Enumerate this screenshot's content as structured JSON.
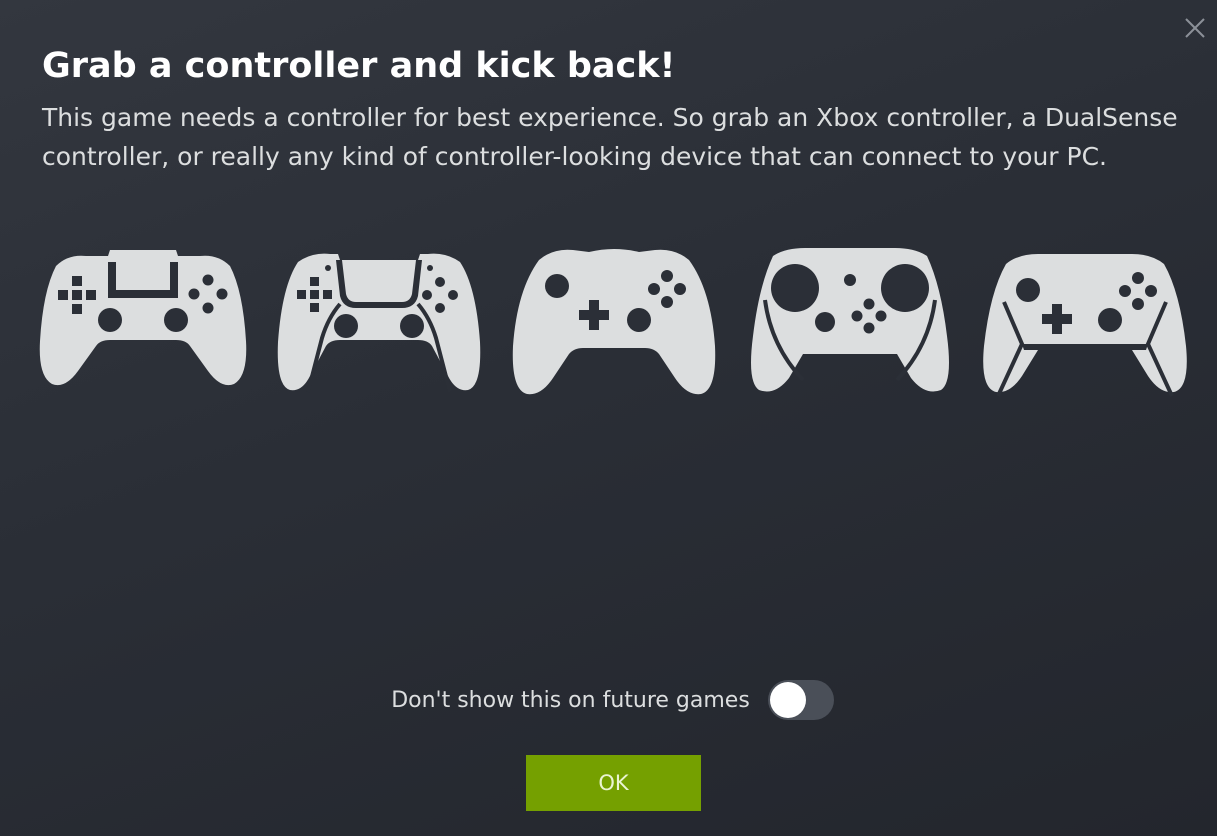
{
  "dialog": {
    "title": "Grab a controller and kick back!",
    "description": "This game needs a controller for best experience. So grab an Xbox controller, a DualSense controller, or really any kind of controller-looking device that can connect to your PC.",
    "close_icon": "close-icon"
  },
  "controllers": [
    {
      "name": "dualshock-controller-icon"
    },
    {
      "name": "dualsense-controller-icon"
    },
    {
      "name": "xbox-controller-icon"
    },
    {
      "name": "steam-controller-icon"
    },
    {
      "name": "switch-pro-controller-icon"
    }
  ],
  "footer": {
    "toggle_label": "Don't show this on future games",
    "toggle_on": false,
    "ok_label": "OK"
  },
  "colors": {
    "background": "#2b2f37",
    "controller_fill": "#dcdedf",
    "accent_button": "#75a000",
    "toggle_track": "#4a4f58"
  }
}
